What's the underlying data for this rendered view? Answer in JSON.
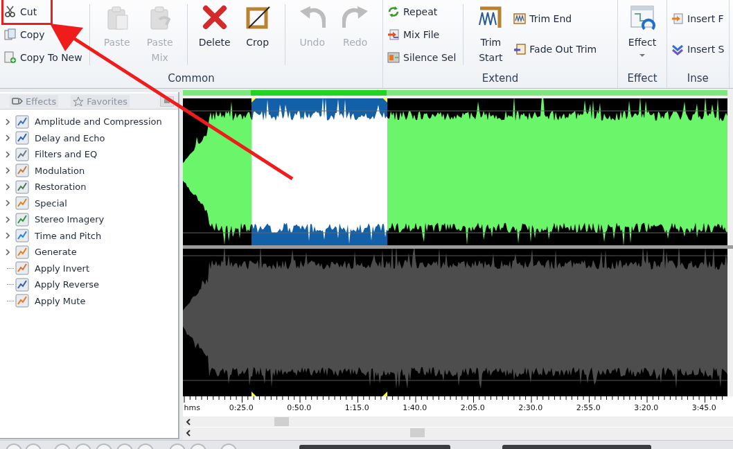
{
  "ribbon": {
    "groups": [
      {
        "label": "Common",
        "columns": [
          {
            "kind": "stack",
            "items": [
              {
                "label": "Cut",
                "disabled": false
              },
              {
                "label": "Copy",
                "disabled": false
              },
              {
                "label": "Copy To New",
                "disabled": false
              }
            ]
          },
          {
            "kind": "separator"
          },
          {
            "kind": "large",
            "label": "Paste",
            "disabled": true
          },
          {
            "kind": "large",
            "label": "Paste Mix",
            "disabled": true
          },
          {
            "kind": "separator"
          },
          {
            "kind": "large",
            "label": "Delete",
            "disabled": false
          },
          {
            "kind": "large",
            "label": "Crop",
            "disabled": false
          },
          {
            "kind": "separator"
          },
          {
            "kind": "large",
            "label": "Undo",
            "disabled": true
          },
          {
            "kind": "large",
            "label": "Redo",
            "disabled": true
          }
        ]
      },
      {
        "label": "Extend",
        "columns": [
          {
            "kind": "stack",
            "items": [
              {
                "label": "Repeat",
                "disabled": false
              },
              {
                "label": "Mix File",
                "disabled": false
              },
              {
                "label": "Silence Sel",
                "disabled": false
              }
            ]
          },
          {
            "kind": "separator"
          },
          {
            "kind": "large",
            "label": "Trim Start",
            "disabled": false
          },
          {
            "kind": "stack",
            "items": [
              {
                "label": "Trim End",
                "disabled": false
              },
              {
                "label": "Fade Out Trim",
                "disabled": false
              }
            ]
          }
        ]
      },
      {
        "label": "Effect",
        "columns": [
          {
            "kind": "large",
            "label": "Effect",
            "disabled": false,
            "dropdown": true
          }
        ]
      },
      {
        "label": "Inse",
        "columns": [
          {
            "kind": "stack",
            "items": [
              {
                "label": "Insert F",
                "disabled": false
              },
              {
                "label": "Insert S",
                "disabled": false
              }
            ]
          }
        ]
      }
    ]
  },
  "sidebar": {
    "tabs": [
      {
        "label": "Effects"
      },
      {
        "label": "Favorites"
      }
    ],
    "tree": [
      {
        "label": "Amplitude and Compression",
        "kind": "folder"
      },
      {
        "label": "Delay and Echo",
        "kind": "folder"
      },
      {
        "label": "Filters and EQ",
        "kind": "folder"
      },
      {
        "label": "Modulation",
        "kind": "folder"
      },
      {
        "label": "Restoration",
        "kind": "folder"
      },
      {
        "label": "Special",
        "kind": "folder"
      },
      {
        "label": "Stereo Imagery",
        "kind": "folder"
      },
      {
        "label": "Time and Pitch",
        "kind": "folder"
      },
      {
        "label": "Generate",
        "kind": "folder"
      },
      {
        "label": "Apply Invert",
        "kind": "leaf"
      },
      {
        "label": "Apply Reverse",
        "kind": "leaf"
      },
      {
        "label": "Apply Mute",
        "kind": "leaf"
      }
    ]
  },
  "ruler": {
    "unit": "hms",
    "labels": [
      "0:25.0",
      "0:50.0",
      "1:15.0",
      "1:40.0",
      "2:05.0",
      "2:30.0",
      "2:55.0",
      "3:20.0",
      "3:45.0"
    ]
  }
}
